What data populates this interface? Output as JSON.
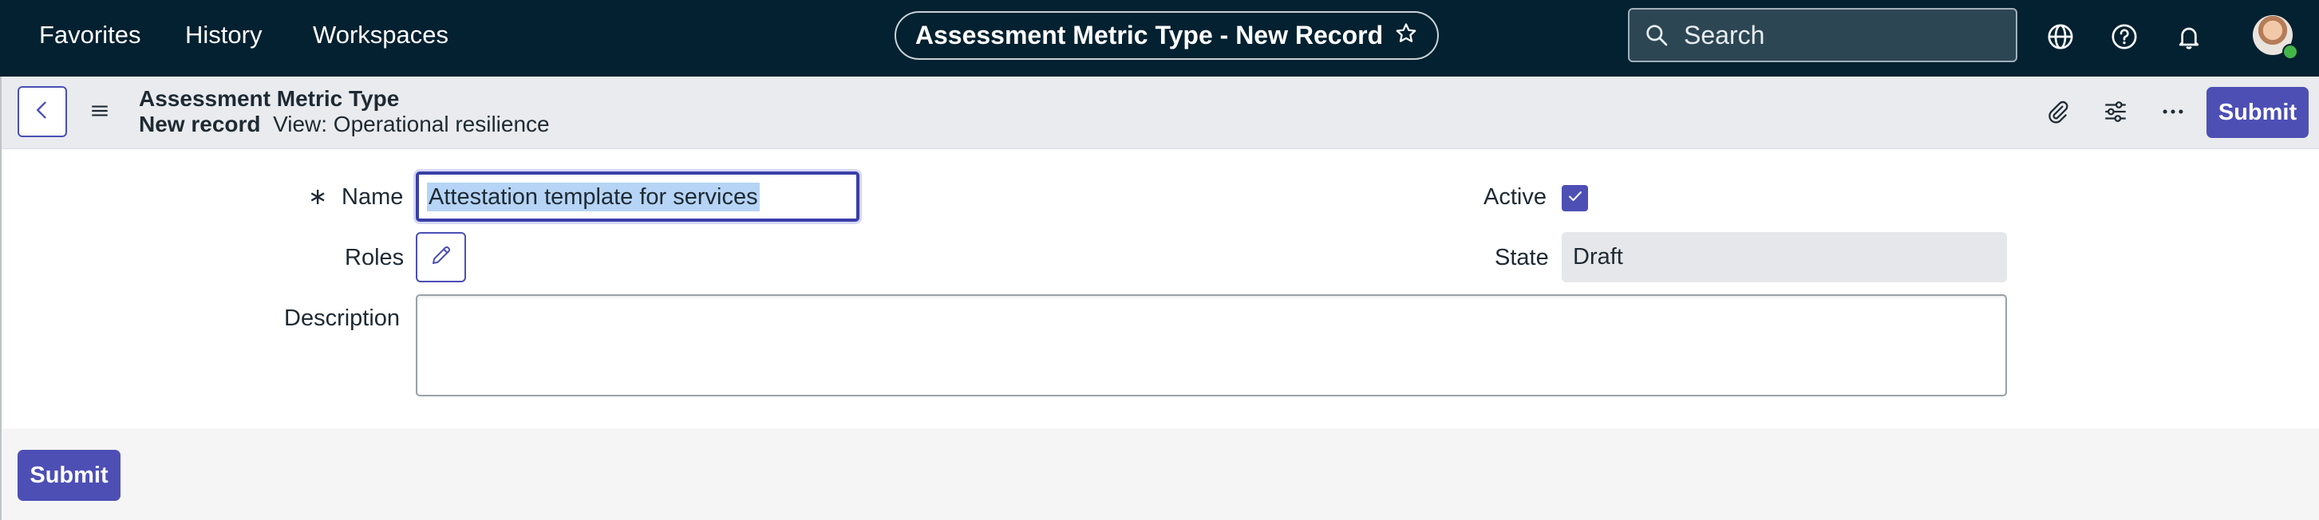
{
  "nav": {
    "favorites": "Favorites",
    "history": "History",
    "workspaces": "Workspaces",
    "page_title": "Assessment Metric Type - New Record",
    "search_placeholder": "Search"
  },
  "header": {
    "table_label": "Assessment Metric Type",
    "record_state": "New record",
    "view_label": "View: Operational resilience",
    "submit_label": "Submit"
  },
  "form": {
    "name_label": "Name",
    "name_value": "Attestation template for services",
    "roles_label": "Roles",
    "description_label": "Description",
    "description_value": "",
    "active_label": "Active",
    "active_checked": true,
    "state_label": "State",
    "state_value": "Draft",
    "mandatory_marker": "∗"
  },
  "footer": {
    "submit_label": "Submit"
  },
  "colors": {
    "topbar": "#032130",
    "accent": "#4d4fb5",
    "presence": "#43b649"
  },
  "icons": [
    "star-icon",
    "search-icon",
    "globe-icon",
    "help-icon",
    "bell-icon",
    "back-icon",
    "menu-icon",
    "paperclip-icon",
    "settings-sliders-icon",
    "more-icon",
    "pencil-icon",
    "check-icon"
  ]
}
